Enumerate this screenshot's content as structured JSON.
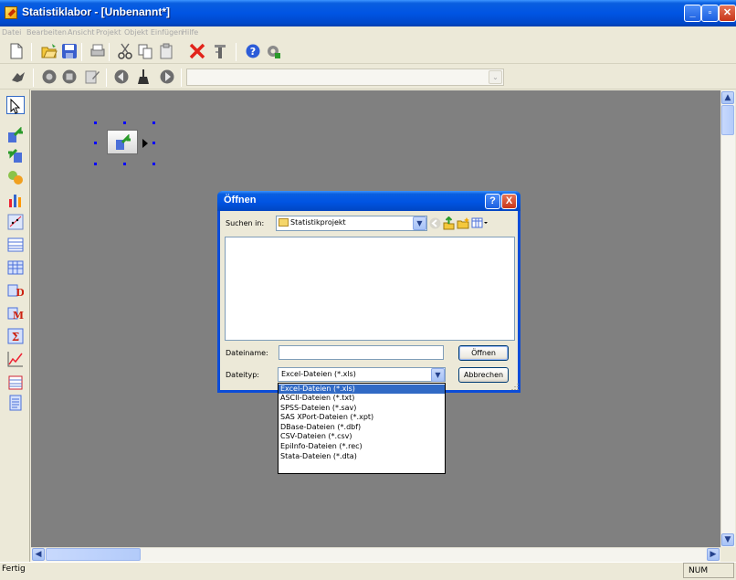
{
  "window": {
    "title": "Statistiklabor - [Unbenannt*]"
  },
  "menu": [
    "Datei",
    "Bearbeiten",
    "Ansicht",
    "Projekt",
    "Objekt Einfügen",
    "Hilfe"
  ],
  "dialog": {
    "title": "Öffnen",
    "look_in_label": "Suchen in:",
    "look_in_value": "Statistikprojekt",
    "filename_label": "Dateiname:",
    "filename_value": "",
    "filetype_label": "Dateityp:",
    "filetype_value": "Excel-Dateien (*.xls)",
    "open_button": "Öffnen",
    "cancel_button": "Abbrechen",
    "help_button": "?",
    "close_button": "X"
  },
  "filetype_options": [
    "Excel-Dateien (*.xls)",
    "ASCII-Dateien (*.txt)",
    "SPSS-Dateien (*.sav)",
    "SAS XPort-Dateien (*.xpt)",
    "DBase-Dateien (*.dbf)",
    "CSV-Dateien (*.csv)",
    "EpiInfo-Dateien (*.rec)",
    "Stata-Dateien (*.dta)"
  ],
  "selected_option_index": 0,
  "status": {
    "text": "Fertig",
    "num": "NUM"
  },
  "colors": {
    "titlebar": "#0054e3",
    "canvas": "#808080",
    "selection": "#316ac5",
    "handles": "#0000ff"
  }
}
